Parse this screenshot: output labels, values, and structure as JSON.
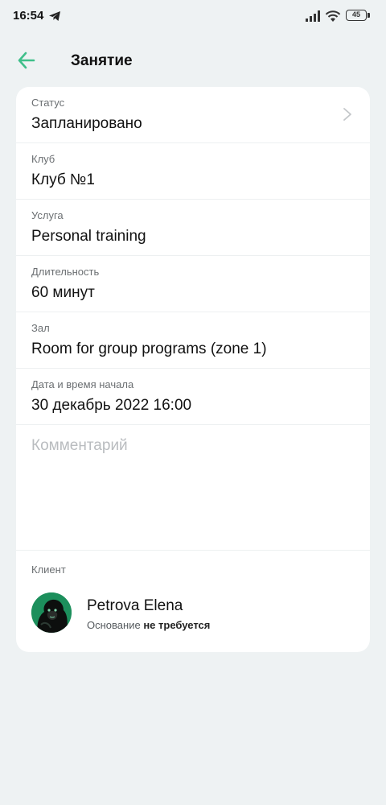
{
  "status_bar": {
    "time": "16:54",
    "battery": "45"
  },
  "header": {
    "title": "Занятие"
  },
  "fields": [
    {
      "label": "Статус",
      "value": "Запланировано"
    },
    {
      "label": "Клуб",
      "value": "Клуб №1"
    },
    {
      "label": "Услуга",
      "value": "Personal training"
    },
    {
      "label": "Длительность",
      "value": "60 минут"
    },
    {
      "label": "Зал",
      "value": "Room for group programs (zone 1)"
    },
    {
      "label": "Дата и время начала",
      "value": "30 декабрь 2022 16:00"
    }
  ],
  "comment": {
    "placeholder": "Комментарий"
  },
  "client": {
    "section_label": "Клиент",
    "name": "Petrova Elena",
    "basis_prefix": "Основание",
    "basis_value": "не требуется"
  },
  "colors": {
    "accent": "#3fbf8a",
    "background": "#eef2f3",
    "card": "#ffffff"
  }
}
